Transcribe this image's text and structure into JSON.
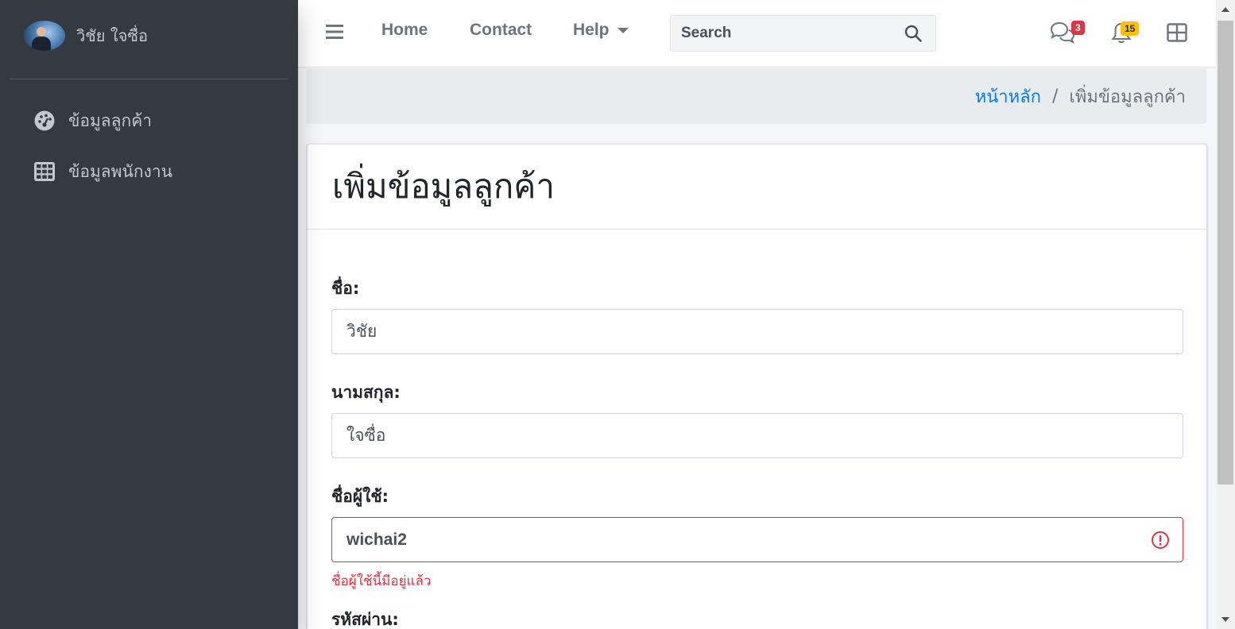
{
  "sidebar": {
    "user_name": "วิชัย ใจซื่อ",
    "items": [
      {
        "label": "ข้อมูลลูกค้า",
        "icon": "tachometer-icon"
      },
      {
        "label": "ข้อมูลพนักงาน",
        "icon": "table-icon"
      }
    ]
  },
  "topbar": {
    "links": [
      "Home",
      "Contact",
      "Help"
    ],
    "search_placeholder": "Search",
    "messages_count": "3",
    "notifications_count": "15"
  },
  "breadcrumb": {
    "home": "หน้าหลัก",
    "separator": "/",
    "current": "เพิ่มข้อมูลลูกค้า"
  },
  "card": {
    "title": "เพิ่มข้อมูลลูกค้า"
  },
  "form": {
    "first_name_label": "ชื่อ:",
    "first_name_value": "วิชัย",
    "last_name_label": "นามสกุล:",
    "last_name_value": "ใจซื่อ",
    "username_label": "ชื่อผู้ใช้:",
    "username_value": "wichai2",
    "username_error": "ชื่อผู้ใช้นี้มีอยู่แล้ว",
    "password_label": "รหัสผ่าน:"
  },
  "colors": {
    "sidebar_bg": "#343a40",
    "link": "#007bff",
    "danger": "#dc3545",
    "warning": "#ffc107"
  }
}
